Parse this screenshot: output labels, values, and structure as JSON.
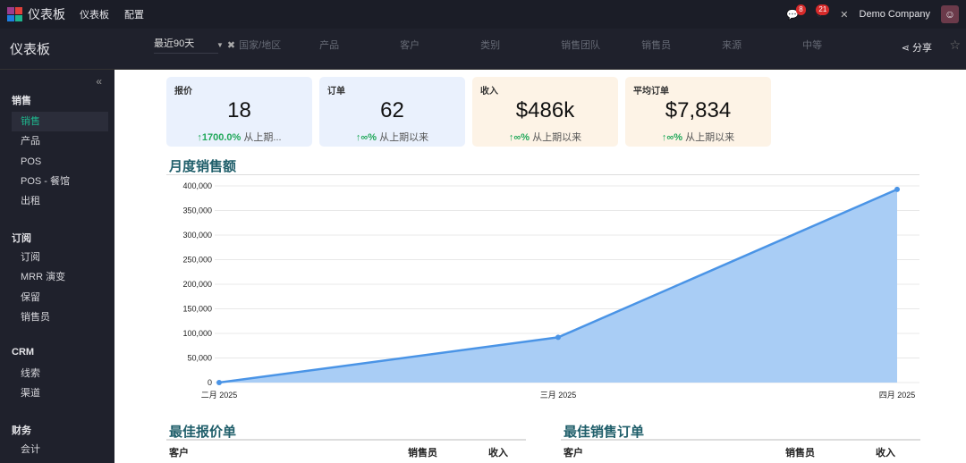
{
  "topbar": {
    "app_title": "仪表板",
    "menu": [
      "仪表板",
      "配置"
    ],
    "messages_count": "8",
    "activities_count": "21",
    "company": "Demo Company",
    "logo_colors": [
      "#9b3d8e",
      "#e0403a",
      "#1e7fe0",
      "#1fb58d",
      "#2eaa5b"
    ]
  },
  "control": {
    "page_title": "仪表板",
    "date_filter": "最近90天",
    "filters": [
      "国家/地区",
      "产品",
      "客户",
      "类别",
      "销售团队",
      "销售员",
      "来源",
      "中等"
    ],
    "share_label": "分享"
  },
  "sidebar": {
    "sections": [
      {
        "title": "销售",
        "items": [
          "销售",
          "产品",
          "POS",
          "POS - 餐馆",
          "出租"
        ]
      },
      {
        "title": "订阅",
        "items": [
          "订阅",
          "MRR 演变",
          "保留",
          "销售员"
        ]
      },
      {
        "title": "CRM",
        "items": [
          "线索",
          "渠道"
        ]
      },
      {
        "title": "财务",
        "items": [
          "会计"
        ]
      }
    ],
    "active": "销售"
  },
  "kpis": [
    {
      "label": "报价",
      "value": "18",
      "change": "↑1700.0%",
      "note": "从上期...",
      "bg": "#eaf1fd"
    },
    {
      "label": "订单",
      "value": "62",
      "change": "↑∞%",
      "note": "从上期以来",
      "bg": "#eaf1fd"
    },
    {
      "label": "收入",
      "value": "$486k",
      "change": "↑∞%",
      "note": "从上期以来",
      "bg": "#fdf3e6"
    },
    {
      "label": "平均订单",
      "value": "$7,834",
      "change": "↑∞%",
      "note": "从上期以来",
      "bg": "#fdf3e6"
    }
  ],
  "chart_data": {
    "type": "area",
    "title": "月度销售额",
    "categories": [
      "二月 2025",
      "三月 2025",
      "四月 2025"
    ],
    "values": [
      0,
      92000,
      393000
    ],
    "ylim": [
      0,
      400000
    ],
    "yticks": [
      0,
      50000,
      100000,
      150000,
      200000,
      250000,
      300000,
      350000,
      400000
    ],
    "ytick_labels": [
      "0",
      "50,000",
      "100,000",
      "150,000",
      "200,000",
      "250,000",
      "300,000",
      "350,000",
      "400,000"
    ],
    "grid": true,
    "color": "#4a94e6"
  },
  "tables": [
    {
      "title": "最佳报价单",
      "headers": [
        "客户",
        "销售员",
        "收入"
      ]
    },
    {
      "title": "最佳销售订单",
      "headers": [
        "客户",
        "销售员",
        "收入"
      ]
    }
  ]
}
